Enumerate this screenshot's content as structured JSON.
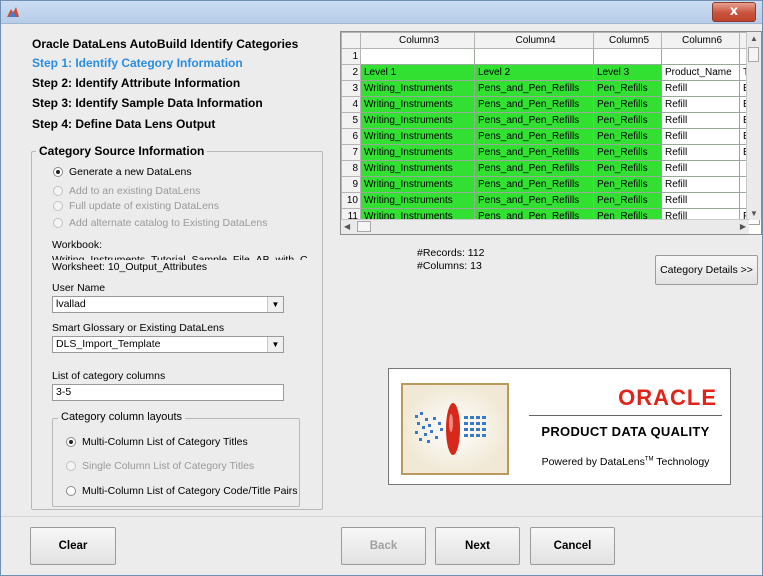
{
  "window": {
    "close_label": "x"
  },
  "steps": {
    "title": "Oracle DataLens AutoBuild Identify Categories",
    "step1": "Step 1: Identify Category Information",
    "step2": "Step 2: Identify Attribute Information",
    "step3": "Step 3: Identify Sample Data Information",
    "step4": "Step 4: Define Data Lens Output"
  },
  "source": {
    "legend": "Category Source Information",
    "options": [
      "Generate a new DataLens",
      "Add to an existing DataLens",
      "Full update of existing DataLens",
      "Add alternate catalog to Existing DataLens"
    ],
    "workbook_label": "Workbook:",
    "workbook_value": "Writing_Instruments_Tutorial_Sample_File_AB_with_Column",
    "worksheet": "Worksheet: 10_Output_Attributes",
    "user_name_label": "User Name",
    "user_name_value": "lvallad",
    "glossary_label": "Smart Glossary or Existing DataLens",
    "glossary_value": "DLS_Import_Template",
    "category_columns_label": "List of category columns",
    "category_columns_value": "3-5",
    "layouts_legend": "Category column layouts",
    "layouts": [
      "Multi-Column List of Category Titles",
      "Single Column List of Category Titles",
      "Multi-Column List of Category Code/Title Pairs"
    ]
  },
  "grid": {
    "columns": [
      "Column3",
      "Column4",
      "Column5",
      "Column6"
    ],
    "rows": [
      [
        "1",
        "",
        "",
        "",
        "",
        ""
      ],
      [
        "2",
        "Level 1",
        "Level 2",
        "Level 3",
        "Product_Name",
        "T"
      ],
      [
        "3",
        "Writing_Instruments",
        "Pens_and_Pen_Refills",
        "Pen_Refills",
        "Refill",
        "E"
      ],
      [
        "4",
        "Writing_Instruments",
        "Pens_and_Pen_Refills",
        "Pen_Refills",
        "Refill",
        "E"
      ],
      [
        "5",
        "Writing_Instruments",
        "Pens_and_Pen_Refills",
        "Pen_Refills",
        "Refill",
        "E"
      ],
      [
        "6",
        "Writing_Instruments",
        "Pens_and_Pen_Refills",
        "Pen_Refills",
        "Refill",
        "E"
      ],
      [
        "7",
        "Writing_Instruments",
        "Pens_and_Pen_Refills",
        "Pen_Refills",
        "Refill",
        "E"
      ],
      [
        "8",
        "Writing_Instruments",
        "Pens_and_Pen_Refills",
        "Pen_Refills",
        "Refill",
        ""
      ],
      [
        "9",
        "Writing_Instruments",
        "Pens_and_Pen_Refills",
        "Pen_Refills",
        "Refill",
        ""
      ],
      [
        "10",
        "Writing_Instruments",
        "Pens_and_Pen_Refills",
        "Pen_Refills",
        "Refill",
        ""
      ],
      [
        "11",
        "Writing_Instruments",
        "Pens_and_Pen_Refills",
        "Pen_Refills",
        "Refill",
        "F"
      ]
    ],
    "highlight_color": "#32e032"
  },
  "stats": {
    "records": "#Records: 112",
    "columns": "#Columns: 13"
  },
  "buttons": {
    "category_details": "Category Details >>",
    "clear": "Clear",
    "back": "Back",
    "next": "Next",
    "cancel": "Cancel"
  },
  "banner": {
    "brand": "ORACLE",
    "product": "PRODUCT DATA QUALITY",
    "powered": "Powered by DataLens",
    "tm": "TM",
    "technology": "Technology"
  },
  "colors": {
    "active_step": "#2a8ee0",
    "oracle_red": "#e2231a"
  }
}
